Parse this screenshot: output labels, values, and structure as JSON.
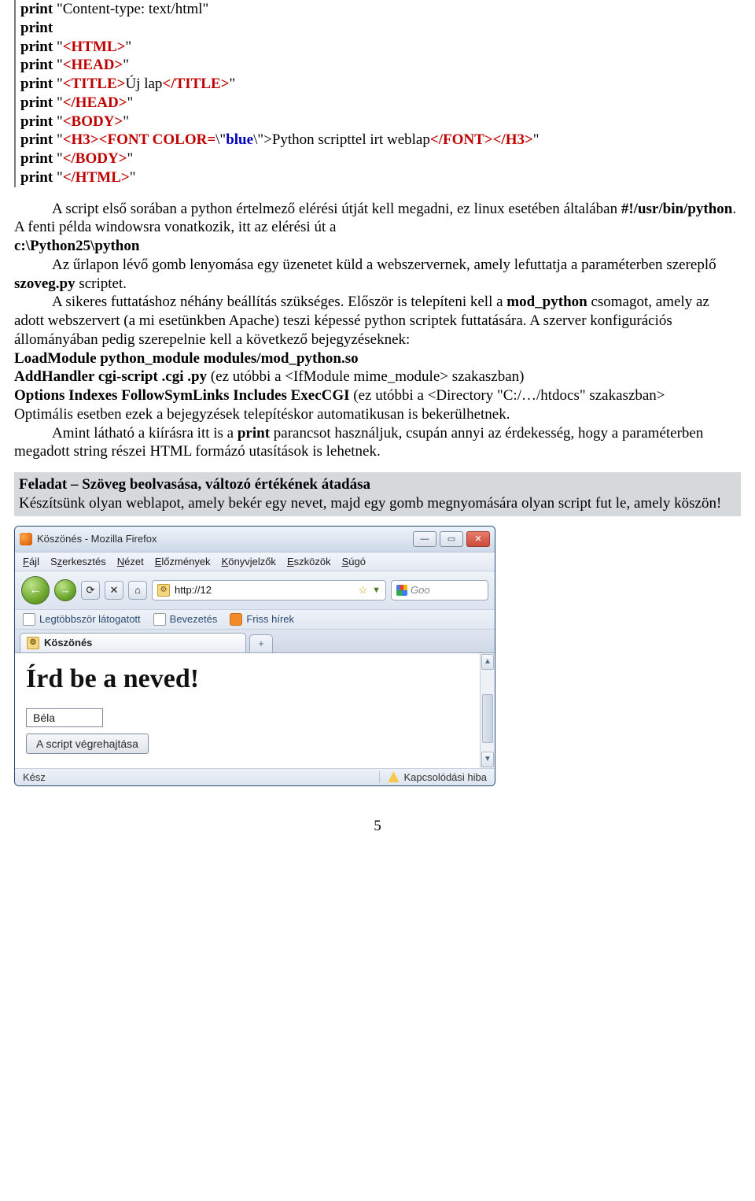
{
  "code": {
    "l1_kw": "print",
    "l1_rest": " \"Content-type: text/html\"",
    "l2_kw": "print",
    "l3_kw": "print",
    "l3_q1": " \"",
    "l3_tag": "<HTML>",
    "l3_q2": "\"",
    "l4_kw": "print",
    "l4_q1": " \"",
    "l4_tag": "<HEAD>",
    "l4_q2": "\"",
    "l5_kw": "print",
    "l5_q1": " \"",
    "l5_tag1": "<TITLE>",
    "l5_mid": "Új lap",
    "l5_tag2": "</TITLE>",
    "l5_q2": "\"",
    "l6_kw": "print",
    "l6_q1": " \"",
    "l6_tag": "</HEAD>",
    "l6_q2": "\"",
    "l7_kw": "print",
    "l7_q1": " \"",
    "l7_tag": "<BODY>",
    "l7_q2": "\"",
    "l8_kw": "print",
    "l8_q1": " \"",
    "l8_tag1": "<H3><FONT COLOR=",
    "l8_bs1": "\\\"",
    "l8_blue": "blue",
    "l8_bs2": "\\\">",
    "l8_mid": "Python scripttel irt weblap",
    "l8_tag2": "</FONT></H3>",
    "l8_q2": "\"",
    "l9_kw": "print",
    "l9_q1": " \"",
    "l9_tag": "</BODY>",
    "l9_q2": "\"",
    "l10_kw": "print",
    "l10_q1": " \"",
    "l10_tag": "</HTML>",
    "l10_q2": "\""
  },
  "body": {
    "p1a": "A script első sorában a python értelmező elérési útját kell megadni, ez linux esetében általában ",
    "p1b": "#!/usr/bin/python",
    "p1c": ". A fenti példa windowsra vonatkozik, itt az elérési út a ",
    "p1d": "c:\\Python25\\python",
    "p2a": "Az űrlapon lévő gomb lenyomása egy üzenetet küld a webszervernek, amely lefuttatja a paraméterben szereplő ",
    "p2b": "szoveg.py",
    "p2c": " scriptet.",
    "p3a": "A sikeres futtatáshoz néhány beállítás szükséges. Először is telepíteni kell a ",
    "p3b": "mod_python",
    "p3c": " csomagot, amely az adott webszervert (a mi esetünkben Apache) teszi képessé python scriptek futtatására. A szerver konfigurációs állományában pedig szerepelnie kell a következő bejegyzéseknek:",
    "p4": "LoadModule python_module modules/mod_python.so",
    "p5a": "AddHandler cgi-script .cgi .py",
    "p5b": " (ez utóbbi a <IfModule mime_module> szakaszban)",
    "p6a": "Options Indexes FollowSymLinks Includes ExecCGI",
    "p6b": " (ez utóbbi a <Directory \"C:/…/htdocs\" szakaszban>",
    "p7": "Optimális esetben ezek a bejegyzések telepítéskor automatikusan is bekerülhetnek.",
    "p8a": "Amint látható a kiírásra itt is a ",
    "p8b": "print",
    "p8c": " parancsot használjuk, csupán annyi az érdekesség, hogy a paraméterben megadott string részei HTML formázó utasítások is lehetnek."
  },
  "task": {
    "title": "Feladat – Szöveg beolvasása, változó értékének átadása",
    "desc": "Készítsünk olyan weblapot, amely bekér egy nevet, majd egy gomb megnyomására olyan script fut le, amely köszön!"
  },
  "firefox": {
    "window_title": "Köszönés - Mozilla Firefox",
    "menu": {
      "m1": "Fájl",
      "m2": "Szerkesztés",
      "m3": "Nézet",
      "m4": "Előzmények",
      "m5": "Könyvjelzők",
      "m6": "Eszközök",
      "m7": "Súgó"
    },
    "addr_favicon": "⚙",
    "addr_url": "http://12",
    "addr_dd": "▼",
    "addr_star": "☆",
    "search_placeholder": "Goo",
    "bookmarks": {
      "b1": "Legtöbbször látogatott",
      "b2": "Bevezetés",
      "b3": "Friss hírek"
    },
    "tab_label": "Köszönés",
    "newtab": "+",
    "page_h1": "Írd be a neved!",
    "input_value": "Béla",
    "button_label": "A script végrehajtása",
    "status_left": "Kész",
    "status_right": "Kapcsolódási hiba"
  },
  "pagenum": "5"
}
